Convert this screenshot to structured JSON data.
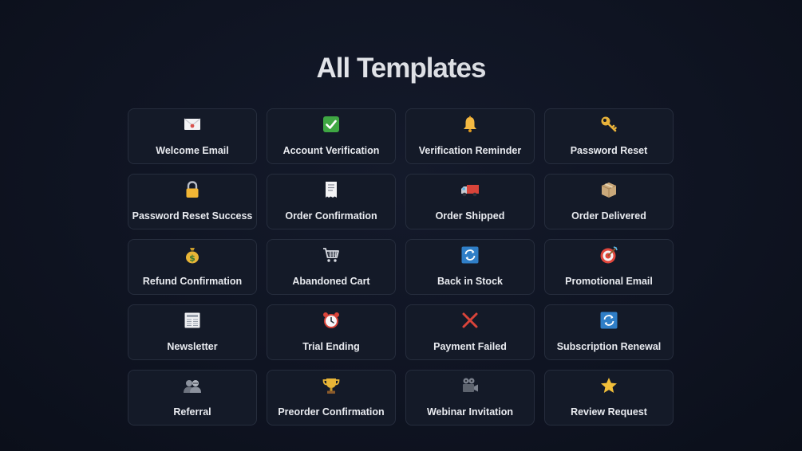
{
  "header": {
    "title": "All Templates"
  },
  "templates": [
    {
      "label": "Welcome Email",
      "icon": "envelope-icon"
    },
    {
      "label": "Account Verification",
      "icon": "check-mark-icon"
    },
    {
      "label": "Verification Reminder",
      "icon": "bell-icon"
    },
    {
      "label": "Password Reset",
      "icon": "key-icon"
    },
    {
      "label": "Password Reset Success",
      "icon": "padlock-icon"
    },
    {
      "label": "Order Confirmation",
      "icon": "receipt-icon"
    },
    {
      "label": "Order Shipped",
      "icon": "delivery-truck-icon"
    },
    {
      "label": "Order Delivered",
      "icon": "package-icon"
    },
    {
      "label": "Refund Confirmation",
      "icon": "money-bag-icon"
    },
    {
      "label": "Abandoned Cart",
      "icon": "shopping-cart-icon"
    },
    {
      "label": "Back in Stock",
      "icon": "refresh-icon"
    },
    {
      "label": "Promotional Email",
      "icon": "target-icon"
    },
    {
      "label": "Newsletter",
      "icon": "newspaper-icon"
    },
    {
      "label": "Trial Ending",
      "icon": "alarm-clock-icon"
    },
    {
      "label": "Payment Failed",
      "icon": "cross-mark-icon"
    },
    {
      "label": "Subscription Renewal",
      "icon": "refresh-icon"
    },
    {
      "label": "Referral",
      "icon": "users-icon"
    },
    {
      "label": "Preorder Confirmation",
      "icon": "trophy-icon"
    },
    {
      "label": "Webinar Invitation",
      "icon": "video-camera-icon"
    },
    {
      "label": "Review Request",
      "icon": "star-icon"
    }
  ]
}
